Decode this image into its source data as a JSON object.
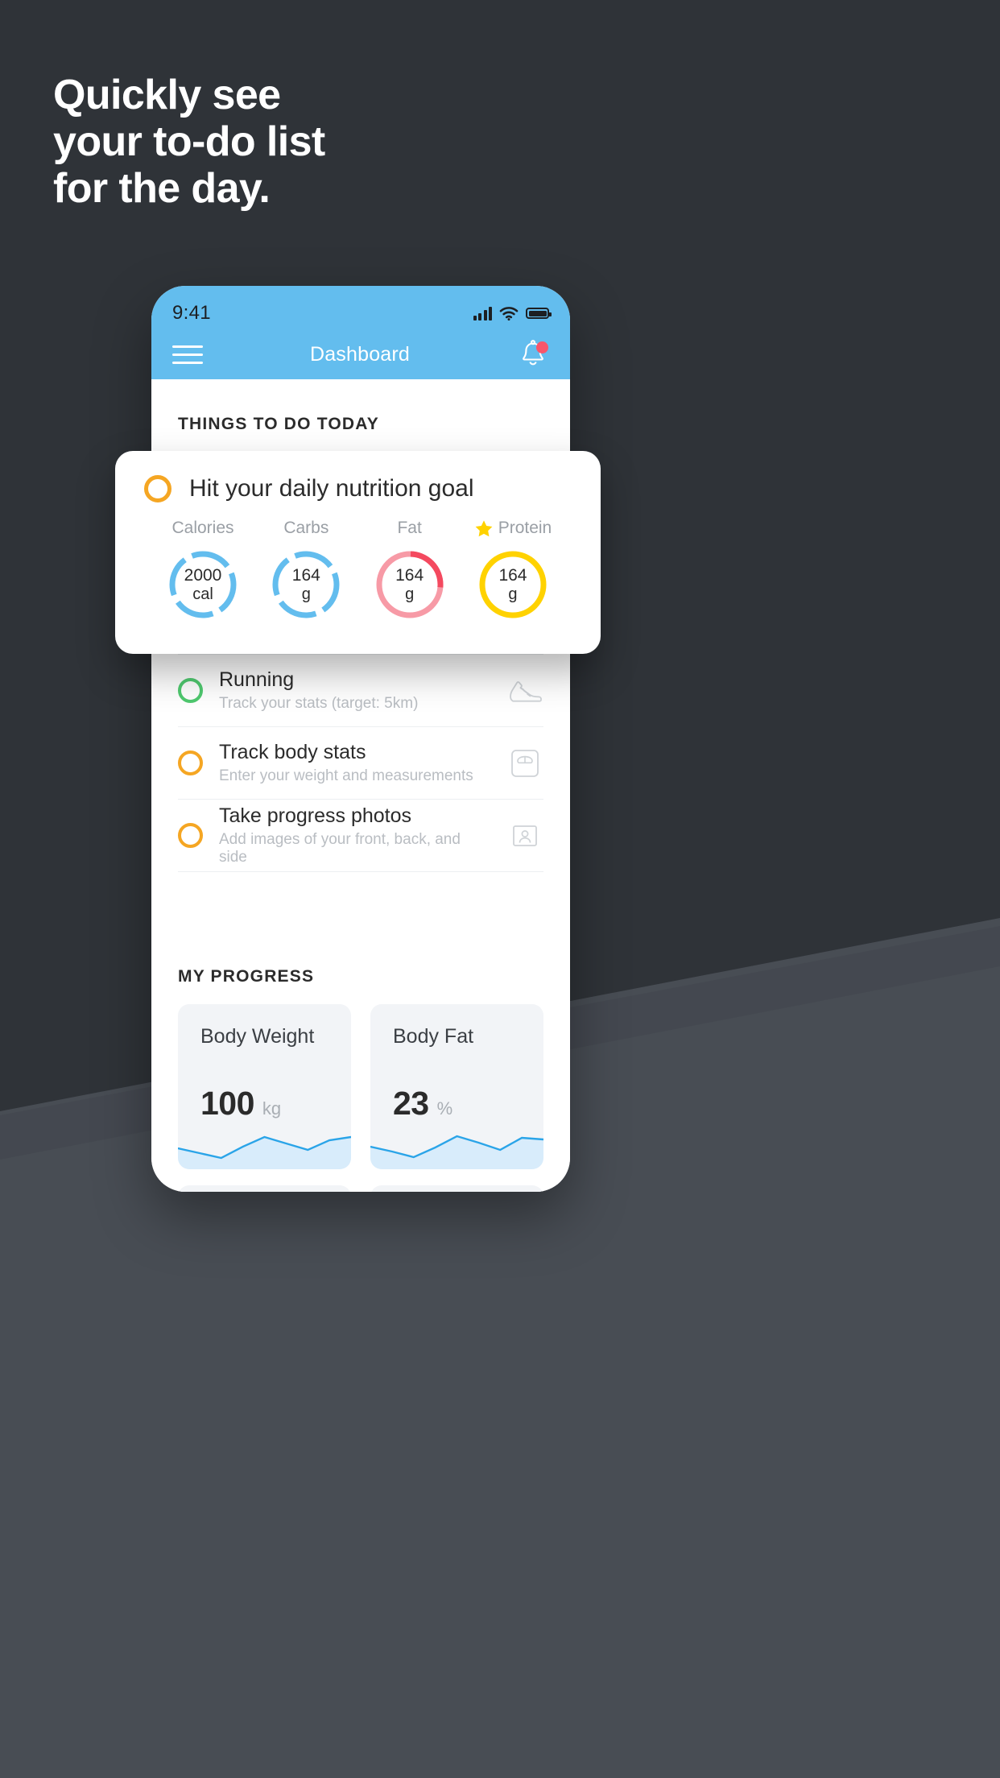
{
  "headline": {
    "lines": [
      "Quickly see",
      "your to-do list",
      "for the day."
    ]
  },
  "colors": {
    "background_top": "#2f3338",
    "background_bottom": "#494e55",
    "brand_blue": "#63bdee",
    "accent_amber": "#f5a623",
    "accent_yellow": "#ffd200",
    "accent_green": "#4fc96f",
    "accent_red": "#f9566b",
    "accent_pink": "#f79aa6",
    "text_dark": "#2b2b2b",
    "text_muted": "#b9bdc2"
  },
  "phone": {
    "status_bar": {
      "time": "9:41",
      "signal_icon": "cellular-signal-icon",
      "wifi_icon": "wifi-icon",
      "battery_icon": "battery-icon"
    },
    "navbar": {
      "menu_icon": "hamburger-menu-icon",
      "title": "Dashboard",
      "bell_icon": "notification-bell-icon",
      "has_notification_dot": true
    },
    "sections": {
      "todo_heading": "THINGS TO DO TODAY",
      "progress_heading": "MY PROGRESS"
    },
    "todo_items": [
      {
        "title": "Hit your daily nutrition goal",
        "subtitle": "",
        "circle_color": "amber",
        "icon": ""
      },
      {
        "title": "Running",
        "subtitle": "Track your stats (target: 5km)",
        "circle_color": "green",
        "icon": "running-shoe-icon"
      },
      {
        "title": "Track body stats",
        "subtitle": "Enter your weight and measurements",
        "circle_color": "amber",
        "icon": "weight-scale-icon"
      },
      {
        "title": "Take progress photos",
        "subtitle": "Add images of your front, back, and side",
        "circle_color": "amber",
        "icon": "person-photo-icon"
      }
    ],
    "progress_cards": [
      {
        "title": "Body Weight",
        "value": "100",
        "unit": "kg"
      },
      {
        "title": "Body Fat",
        "value": "23",
        "unit": "%"
      }
    ]
  },
  "nutrition_card": {
    "checkbox_color": "amber",
    "title": "Hit your daily nutrition goal",
    "metrics": [
      {
        "label": "Calories",
        "value": "2000",
        "unit": "cal",
        "ring_color": "#63bdee",
        "starred": false
      },
      {
        "label": "Carbs",
        "value": "164",
        "unit": "g",
        "ring_color": "#63bdee",
        "starred": false
      },
      {
        "label": "Fat",
        "value": "164",
        "unit": "g",
        "ring_color": "#f79aa6",
        "starred": false
      },
      {
        "label": "Protein",
        "value": "164",
        "unit": "g",
        "ring_color": "#ffd200",
        "starred": true
      }
    ],
    "star_icon": "star-icon"
  },
  "chart_data": [
    {
      "type": "area",
      "title": "Body Weight",
      "ylabel": "kg",
      "x": [
        0,
        1,
        2,
        3,
        4,
        5,
        6,
        7,
        8
      ],
      "values": [
        42,
        36,
        30,
        44,
        58,
        48,
        40,
        52,
        56
      ],
      "current_value": 100,
      "unit": "kg",
      "line_color": "#2aa4e8",
      "fill_color": "#d8ecfb",
      "grid": false,
      "legend": "none"
    },
    {
      "type": "area",
      "title": "Body Fat",
      "ylabel": "%",
      "x": [
        0,
        1,
        2,
        3,
        4,
        5,
        6,
        7,
        8
      ],
      "values": [
        44,
        38,
        32,
        46,
        60,
        50,
        42,
        58,
        56
      ],
      "current_value": 23,
      "unit": "%",
      "line_color": "#2aa4e8",
      "fill_color": "#d8ecfb",
      "grid": false,
      "legend": "none"
    }
  ]
}
